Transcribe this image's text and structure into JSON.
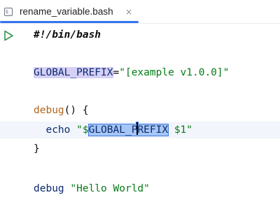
{
  "tab": {
    "title": "rename_variable.bash",
    "close_glyph": "×",
    "file_icon_glyph": "$_",
    "accent_color": "#3574f0"
  },
  "gutter": {
    "run_icon": "run-icon",
    "run_icon_color": "#369650"
  },
  "code": {
    "line1": "#!/bin/bash",
    "line3_var": "GLOBAL_PREFIX",
    "line3_eq": "=",
    "line3_value": "\"[example v1.0.0]\"",
    "line5_fn": "debug",
    "line5_rest": "() {",
    "line6_cmd": "echo",
    "line6_str_open": "\"$",
    "line6_rename_a": "GLOBAL_P",
    "line6_rename_b": "REFIX",
    "line6_str_close": " $1\"",
    "line7": "}",
    "line9_fn": "debug",
    "line9_str": "\"Hello World\""
  }
}
